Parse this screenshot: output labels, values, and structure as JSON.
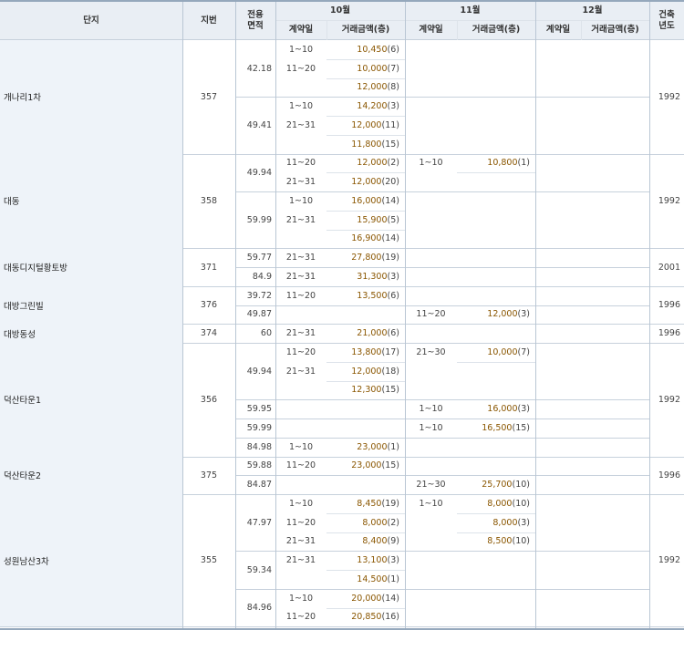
{
  "header": {
    "complex": "단지",
    "lot": "지번",
    "area_line1": "전용",
    "area_line2": "면적",
    "months": [
      "10월",
      "11월",
      "12월"
    ],
    "contract_date": "계약일",
    "amount": "거래금액(층)",
    "year_line1": "건축",
    "year_line2": "년도"
  },
  "complexes": [
    {
      "name": "개나리1차",
      "lot": "357",
      "year": "1992",
      "groups": [
        {
          "area": "42.18",
          "rows": [
            {
              "oct_date": "1~10",
              "oct_price": "10,450",
              "oct_floor": "(6)"
            },
            {
              "oct_date": "11~20",
              "oct_price": "10,000",
              "oct_floor": "(7)"
            },
            {
              "oct_date": "",
              "oct_price": "12,000",
              "oct_floor": "(8)"
            }
          ]
        },
        {
          "area": "49.41",
          "rows": [
            {
              "oct_date": "1~10",
              "oct_price": "14,200",
              "oct_floor": "(3)"
            },
            {
              "oct_date": "21~31",
              "oct_price": "12,000",
              "oct_floor": "(11)"
            },
            {
              "oct_date": "",
              "oct_price": "11,800",
              "oct_floor": "(15)"
            }
          ]
        }
      ]
    },
    {
      "name": "대동",
      "lot": "358",
      "year": "1992",
      "groups": [
        {
          "area": "49.94",
          "rows": [
            {
              "oct_date": "11~20",
              "oct_price": "12,000",
              "oct_floor": "(2)",
              "nov_date": "1~10",
              "nov_price": "10,800",
              "nov_floor": "(1)"
            },
            {
              "oct_date": "21~31",
              "oct_price": "12,000",
              "oct_floor": "(20)"
            }
          ]
        },
        {
          "area": "59.99",
          "rows": [
            {
              "oct_date": "1~10",
              "oct_price": "16,000",
              "oct_floor": "(14)"
            },
            {
              "oct_date": "21~31",
              "oct_price": "15,900",
              "oct_floor": "(5)"
            },
            {
              "oct_date": "",
              "oct_price": "16,900",
              "oct_floor": "(14)"
            }
          ]
        }
      ]
    },
    {
      "name": "대동디지털황토방",
      "lot": "371",
      "year": "2001",
      "groups": [
        {
          "area": "59.77",
          "rows": [
            {
              "oct_date": "21~31",
              "oct_price": "27,800",
              "oct_floor": "(19)"
            }
          ]
        },
        {
          "area": "84.9",
          "rows": [
            {
              "oct_date": "21~31",
              "oct_price": "31,300",
              "oct_floor": "(3)"
            }
          ]
        }
      ]
    },
    {
      "name": "대방그린빌",
      "lot": "376",
      "year": "1996",
      "groups": [
        {
          "area": "39.72",
          "rows": [
            {
              "oct_date": "11~20",
              "oct_price": "13,500",
              "oct_floor": "(6)"
            }
          ]
        },
        {
          "area": "49.87",
          "rows": [
            {
              "nov_date": "11~20",
              "nov_price": "12,000",
              "nov_floor": "(3)"
            }
          ]
        }
      ]
    },
    {
      "name": "대방동성",
      "lot": "374",
      "year": "1996",
      "groups": [
        {
          "area": "60",
          "rows": [
            {
              "oct_date": "21~31",
              "oct_price": "21,000",
              "oct_floor": "(6)"
            }
          ]
        }
      ]
    },
    {
      "name": "덕산타운1",
      "lot": "356",
      "year": "1992",
      "groups": [
        {
          "area": "49.94",
          "rows": [
            {
              "oct_date": "11~20",
              "oct_price": "13,800",
              "oct_floor": "(17)",
              "nov_date": "21~30",
              "nov_price": "10,000",
              "nov_floor": "(7)"
            },
            {
              "oct_date": "21~31",
              "oct_price": "12,000",
              "oct_floor": "(18)"
            },
            {
              "oct_date": "",
              "oct_price": "12,300",
              "oct_floor": "(15)"
            }
          ]
        },
        {
          "area": "59.95",
          "rows": [
            {
              "nov_date": "1~10",
              "nov_price": "16,000",
              "nov_floor": "(3)"
            }
          ]
        },
        {
          "area": "59.99",
          "rows": [
            {
              "nov_date": "1~10",
              "nov_price": "16,500",
              "nov_floor": "(15)"
            }
          ]
        },
        {
          "area": "84.98",
          "rows": [
            {
              "oct_date": "1~10",
              "oct_price": "23,000",
              "oct_floor": "(1)"
            }
          ]
        }
      ]
    },
    {
      "name": "덕산타운2",
      "lot": "375",
      "year": "1996",
      "groups": [
        {
          "area": "59.88",
          "rows": [
            {
              "oct_date": "11~20",
              "oct_price": "23,000",
              "oct_floor": "(15)"
            }
          ]
        },
        {
          "area": "84.87",
          "rows": [
            {
              "nov_date": "21~30",
              "nov_price": "25,700",
              "nov_floor": "(10)"
            }
          ]
        }
      ]
    },
    {
      "name": "성원남산3차",
      "lot": "355",
      "year": "1992",
      "groups": [
        {
          "area": "47.97",
          "rows": [
            {
              "oct_date": "1~10",
              "oct_price": "8,450",
              "oct_floor": "(19)",
              "nov_date": "1~10",
              "nov_price": "8,000",
              "nov_floor": "(10)"
            },
            {
              "oct_date": "11~20",
              "oct_price": "8,000",
              "oct_floor": "(2)",
              "nov_price": "8,000",
              "nov_floor": "(3)"
            },
            {
              "oct_date": "21~31",
              "oct_price": "8,400",
              "oct_floor": "(9)",
              "nov_price": "8,500",
              "nov_floor": "(10)"
            }
          ]
        },
        {
          "area": "59.34",
          "rows": [
            {
              "oct_date": "21~31",
              "oct_price": "13,100",
              "oct_floor": "(3)"
            },
            {
              "oct_date": "",
              "oct_price": "14,500",
              "oct_floor": "(1)"
            }
          ]
        },
        {
          "area": "84.96",
          "rows": [
            {
              "oct_date": "1~10",
              "oct_price": "20,000",
              "oct_floor": "(14)"
            },
            {
              "oct_date": "11~20",
              "oct_price": "20,850",
              "oct_floor": "(16)"
            }
          ]
        }
      ]
    }
  ]
}
